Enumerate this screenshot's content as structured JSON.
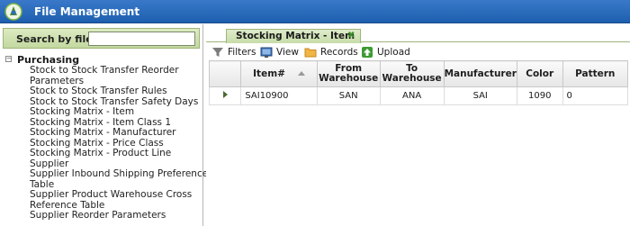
{
  "app": {
    "title": "File Management"
  },
  "search": {
    "label": "Search by file:",
    "value": "",
    "placeholder": ""
  },
  "tree": {
    "category": "Purchasing",
    "items": [
      "Stock to Stock Transfer Reorder",
      "Parameters",
      "Stock to Stock Transfer Rules",
      "Stock to Stock Transfer Safety Days",
      "Stocking Matrix - Item",
      "Stocking Matrix - Item Class 1",
      "Stocking Matrix - Manufacturer",
      "Stocking Matrix - Price Class",
      "Stocking Matrix - Product Line",
      "Supplier",
      "Supplier Inbound Shipping Preference",
      "Table",
      "Supplier Product Warehouse Cross",
      "Reference Table",
      "Supplier Reorder Parameters"
    ]
  },
  "tab": {
    "label": "Stocking Matrix - Item"
  },
  "toolbar": {
    "filters": "Filters",
    "view": "View",
    "records": "Records",
    "upload": "Upload"
  },
  "grid": {
    "headers": [
      "Item#",
      "From Warehouse",
      "To Warehouse",
      "Manufacturer",
      "Color",
      "Pattern"
    ],
    "rows": [
      [
        "SAI10900",
        "SAN",
        "ANA",
        "SAI",
        "1090",
        "0"
      ]
    ]
  }
}
